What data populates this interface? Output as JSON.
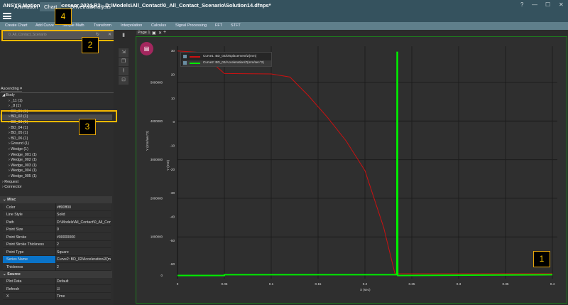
{
  "window": {
    "title": "ANSYS Motion Postprocessor  2024 R2 - D:\\Models\\All_Contact\\0_All_Contact_Scenario\\Solution14.dfnps*",
    "help": "?",
    "minimize": "—",
    "maximize": "☐",
    "close": "✕"
  },
  "menu": {
    "items": [
      "Animation",
      "Chart",
      "Drivetrain",
      "Analysis"
    ],
    "active": "Chart"
  },
  "ribbon": {
    "items": [
      "Create Chart",
      "Add Curve",
      "Simple Math",
      "Transform",
      "Interpolation",
      "Calculus",
      "Signal Processing",
      "FFT",
      "STFT"
    ]
  },
  "search": {
    "value": "0_All_Contact_Scenario"
  },
  "sort": {
    "label": "Ascending"
  },
  "tree": {
    "root": "Body",
    "children": [
      "_11 (1)",
      "_8 (1)",
      "BD_01 (1)",
      "BD_02 (1)",
      "BD_03 (1)",
      "BD_04 (1)",
      "BD_05 (1)",
      "BD_06 (1)",
      "Ground (1)",
      "Wedge (1)",
      "Wedge_001 (1)",
      "Wedge_002 (1)",
      "Wedge_003 (1)",
      "Wedge_004 (1)",
      "Wedge_005 (1)"
    ],
    "others": [
      "Request",
      "Connector"
    ]
  },
  "properties": {
    "misc_label": "Misc",
    "misc": [
      {
        "k": "Color",
        "v": "#ff00ff00"
      },
      {
        "k": "Line Style",
        "v": "Solid"
      },
      {
        "k": "Path",
        "v": "D:\\Models\\All_Contact\\0_All_Contact"
      },
      {
        "k": "Point Size",
        "v": "0"
      },
      {
        "k": "Point Stroke",
        "v": "#00000000"
      },
      {
        "k": "Point Stroke Thickness",
        "v": "2"
      },
      {
        "k": "Point Type",
        "v": "Square"
      },
      {
        "k": "Series Name",
        "v": "Curve2: BD_02/Acceleration/Z(mm/sec^2)"
      },
      {
        "k": "Thickness",
        "v": "2"
      }
    ],
    "source_label": "Source",
    "source": [
      {
        "k": "Plot Data",
        "v": "Default"
      },
      {
        "k": "Refresh",
        "v": "☑"
      },
      {
        "k": "X",
        "v": "Time"
      }
    ]
  },
  "chart_tabs": {
    "page": "Page 1",
    "add": "+"
  },
  "callouts": [
    "1",
    "2",
    "3",
    "4"
  ],
  "colors": {
    "curve1": "#cc1111",
    "curve2": "#00ee00",
    "accent": "#f5b800"
  },
  "chart_data": {
    "type": "line",
    "xlabel": "X (sec)",
    "ylabel_left": "Y (mm)",
    "ylabel_left2": "Y (mm/sec^2)",
    "xlim": [
      0,
      0.4
    ],
    "xticks": [
      "0",
      "0.05",
      "0.1",
      "0.15",
      "0.2",
      "0.25",
      "0.3",
      "0.35",
      "0.4"
    ],
    "ylim_mm": [
      -64,
      30
    ],
    "yticks_mm": [
      "30",
      "20",
      "10",
      "0",
      "-10",
      "-20",
      "-30",
      "-40",
      "-50",
      "-60"
    ],
    "ylim_acc": [
      0,
      5800000
    ],
    "yticks_acc": [
      "5000000",
      "4000000",
      "3000000",
      "2000000",
      "1000000",
      "0"
    ],
    "grid": true,
    "legend_placement": "top-left",
    "series": [
      {
        "name": "Curve1: BD_02/Displacement/Z(mm)",
        "axis": "mm",
        "color": "#cc1111",
        "x": [
          0,
          0.02,
          0.04,
          0.05,
          0.1,
          0.12,
          0.14,
          0.15,
          0.16,
          0.18,
          0.2,
          0.22,
          0.232,
          0.4
        ],
        "y": [
          30,
          29.5,
          24,
          20.5,
          20.3,
          19,
          11,
          6.5,
          2,
          -8,
          -20.5,
          -44.5,
          -64,
          -64
        ]
      },
      {
        "name": "Curve2: BD_02/Acceleration/Z(mm/sec^2)",
        "axis": "acc",
        "color": "#00ee00",
        "x": [
          0,
          0.05,
          0.05,
          0.234,
          0.2343,
          0.2347,
          0.235,
          0.4
        ],
        "y": [
          0,
          0,
          20000,
          20000,
          5780000,
          5780000,
          0,
          20000
        ]
      }
    ]
  }
}
